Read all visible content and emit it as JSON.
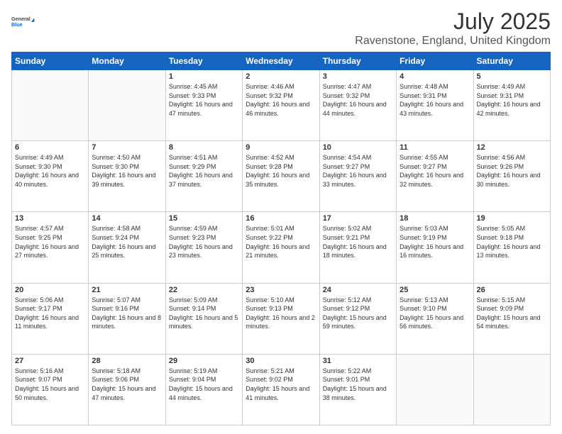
{
  "header": {
    "logo_general": "General",
    "logo_blue": "Blue",
    "month": "July 2025",
    "location": "Ravenstone, England, United Kingdom"
  },
  "weekdays": [
    "Sunday",
    "Monday",
    "Tuesday",
    "Wednesday",
    "Thursday",
    "Friday",
    "Saturday"
  ],
  "weeks": [
    [
      {
        "day": "",
        "sunrise": "",
        "sunset": "",
        "daylight": ""
      },
      {
        "day": "",
        "sunrise": "",
        "sunset": "",
        "daylight": ""
      },
      {
        "day": "1",
        "sunrise": "Sunrise: 4:45 AM",
        "sunset": "Sunset: 9:33 PM",
        "daylight": "Daylight: 16 hours and 47 minutes."
      },
      {
        "day": "2",
        "sunrise": "Sunrise: 4:46 AM",
        "sunset": "Sunset: 9:32 PM",
        "daylight": "Daylight: 16 hours and 46 minutes."
      },
      {
        "day": "3",
        "sunrise": "Sunrise: 4:47 AM",
        "sunset": "Sunset: 9:32 PM",
        "daylight": "Daylight: 16 hours and 44 minutes."
      },
      {
        "day": "4",
        "sunrise": "Sunrise: 4:48 AM",
        "sunset": "Sunset: 9:31 PM",
        "daylight": "Daylight: 16 hours and 43 minutes."
      },
      {
        "day": "5",
        "sunrise": "Sunrise: 4:49 AM",
        "sunset": "Sunset: 9:31 PM",
        "daylight": "Daylight: 16 hours and 42 minutes."
      }
    ],
    [
      {
        "day": "6",
        "sunrise": "Sunrise: 4:49 AM",
        "sunset": "Sunset: 9:30 PM",
        "daylight": "Daylight: 16 hours and 40 minutes."
      },
      {
        "day": "7",
        "sunrise": "Sunrise: 4:50 AM",
        "sunset": "Sunset: 9:30 PM",
        "daylight": "Daylight: 16 hours and 39 minutes."
      },
      {
        "day": "8",
        "sunrise": "Sunrise: 4:51 AM",
        "sunset": "Sunset: 9:29 PM",
        "daylight": "Daylight: 16 hours and 37 minutes."
      },
      {
        "day": "9",
        "sunrise": "Sunrise: 4:52 AM",
        "sunset": "Sunset: 9:28 PM",
        "daylight": "Daylight: 16 hours and 35 minutes."
      },
      {
        "day": "10",
        "sunrise": "Sunrise: 4:54 AM",
        "sunset": "Sunset: 9:27 PM",
        "daylight": "Daylight: 16 hours and 33 minutes."
      },
      {
        "day": "11",
        "sunrise": "Sunrise: 4:55 AM",
        "sunset": "Sunset: 9:27 PM",
        "daylight": "Daylight: 16 hours and 32 minutes."
      },
      {
        "day": "12",
        "sunrise": "Sunrise: 4:56 AM",
        "sunset": "Sunset: 9:26 PM",
        "daylight": "Daylight: 16 hours and 30 minutes."
      }
    ],
    [
      {
        "day": "13",
        "sunrise": "Sunrise: 4:57 AM",
        "sunset": "Sunset: 9:25 PM",
        "daylight": "Daylight: 16 hours and 27 minutes."
      },
      {
        "day": "14",
        "sunrise": "Sunrise: 4:58 AM",
        "sunset": "Sunset: 9:24 PM",
        "daylight": "Daylight: 16 hours and 25 minutes."
      },
      {
        "day": "15",
        "sunrise": "Sunrise: 4:59 AM",
        "sunset": "Sunset: 9:23 PM",
        "daylight": "Daylight: 16 hours and 23 minutes."
      },
      {
        "day": "16",
        "sunrise": "Sunrise: 5:01 AM",
        "sunset": "Sunset: 9:22 PM",
        "daylight": "Daylight: 16 hours and 21 minutes."
      },
      {
        "day": "17",
        "sunrise": "Sunrise: 5:02 AM",
        "sunset": "Sunset: 9:21 PM",
        "daylight": "Daylight: 16 hours and 18 minutes."
      },
      {
        "day": "18",
        "sunrise": "Sunrise: 5:03 AM",
        "sunset": "Sunset: 9:19 PM",
        "daylight": "Daylight: 16 hours and 16 minutes."
      },
      {
        "day": "19",
        "sunrise": "Sunrise: 5:05 AM",
        "sunset": "Sunset: 9:18 PM",
        "daylight": "Daylight: 16 hours and 13 minutes."
      }
    ],
    [
      {
        "day": "20",
        "sunrise": "Sunrise: 5:06 AM",
        "sunset": "Sunset: 9:17 PM",
        "daylight": "Daylight: 16 hours and 11 minutes."
      },
      {
        "day": "21",
        "sunrise": "Sunrise: 5:07 AM",
        "sunset": "Sunset: 9:16 PM",
        "daylight": "Daylight: 16 hours and 8 minutes."
      },
      {
        "day": "22",
        "sunrise": "Sunrise: 5:09 AM",
        "sunset": "Sunset: 9:14 PM",
        "daylight": "Daylight: 16 hours and 5 minutes."
      },
      {
        "day": "23",
        "sunrise": "Sunrise: 5:10 AM",
        "sunset": "Sunset: 9:13 PM",
        "daylight": "Daylight: 16 hours and 2 minutes."
      },
      {
        "day": "24",
        "sunrise": "Sunrise: 5:12 AM",
        "sunset": "Sunset: 9:12 PM",
        "daylight": "Daylight: 15 hours and 59 minutes."
      },
      {
        "day": "25",
        "sunrise": "Sunrise: 5:13 AM",
        "sunset": "Sunset: 9:10 PM",
        "daylight": "Daylight: 15 hours and 56 minutes."
      },
      {
        "day": "26",
        "sunrise": "Sunrise: 5:15 AM",
        "sunset": "Sunset: 9:09 PM",
        "daylight": "Daylight: 15 hours and 54 minutes."
      }
    ],
    [
      {
        "day": "27",
        "sunrise": "Sunrise: 5:16 AM",
        "sunset": "Sunset: 9:07 PM",
        "daylight": "Daylight: 15 hours and 50 minutes."
      },
      {
        "day": "28",
        "sunrise": "Sunrise: 5:18 AM",
        "sunset": "Sunset: 9:06 PM",
        "daylight": "Daylight: 15 hours and 47 minutes."
      },
      {
        "day": "29",
        "sunrise": "Sunrise: 5:19 AM",
        "sunset": "Sunset: 9:04 PM",
        "daylight": "Daylight: 15 hours and 44 minutes."
      },
      {
        "day": "30",
        "sunrise": "Sunrise: 5:21 AM",
        "sunset": "Sunset: 9:02 PM",
        "daylight": "Daylight: 15 hours and 41 minutes."
      },
      {
        "day": "31",
        "sunrise": "Sunrise: 5:22 AM",
        "sunset": "Sunset: 9:01 PM",
        "daylight": "Daylight: 15 hours and 38 minutes."
      },
      {
        "day": "",
        "sunrise": "",
        "sunset": "",
        "daylight": ""
      },
      {
        "day": "",
        "sunrise": "",
        "sunset": "",
        "daylight": ""
      }
    ]
  ]
}
